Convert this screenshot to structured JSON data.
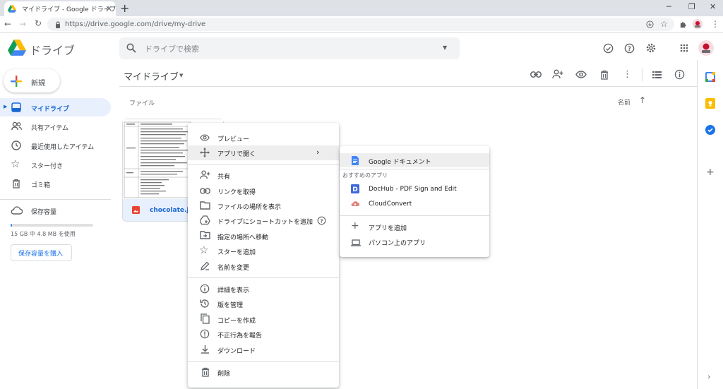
{
  "browser": {
    "tab_title": "マイドライブ - Google ドライブ",
    "url": "https://drive.google.com/drive/my-drive"
  },
  "header": {
    "app_name": "ドライブ",
    "search_placeholder": "ドライブで検索"
  },
  "sidebar": {
    "new_label": "新規",
    "items": [
      {
        "label": "マイドライブ",
        "icon": "drive-icon",
        "active": true
      },
      {
        "label": "共有アイテム",
        "icon": "people-icon"
      },
      {
        "label": "最近使用したアイテム",
        "icon": "clock-icon"
      },
      {
        "label": "スター付き",
        "icon": "star-icon"
      },
      {
        "label": "ゴミ箱",
        "icon": "trash-icon"
      }
    ],
    "storage_label": "保存容量",
    "storage_usage": "15 GB 中 4.8 MB を使用",
    "storage_used_fraction": 0.0003,
    "buy_storage_label": "保存容量を購入"
  },
  "main": {
    "title": "マイドライブ",
    "files_heading": "ファイル",
    "sort_label": "名前",
    "file": {
      "name": "chocolate.jpg"
    }
  },
  "context_menu": {
    "items": [
      {
        "label": "プレビュー",
        "icon": "eye-icon"
      },
      {
        "label": "アプリで開く",
        "icon": "move-icon",
        "highlighted": true,
        "submenu": true
      },
      {
        "label": "共有",
        "icon": "person-add-icon"
      },
      {
        "label": "リンクを取得",
        "icon": "link-icon"
      },
      {
        "label": "ファイルの場所を表示",
        "icon": "folder-icon"
      },
      {
        "label": "ドライブにショートカットを追加",
        "icon": "shortcut-icon",
        "help": true
      },
      {
        "label": "指定の場所へ移動",
        "icon": "folder-move-icon"
      },
      {
        "label": "スターを追加",
        "icon": "star-icon"
      },
      {
        "label": "名前を変更",
        "icon": "pencil-icon"
      },
      {
        "label": "詳細を表示",
        "icon": "info-icon"
      },
      {
        "label": "版を管理",
        "icon": "history-icon"
      },
      {
        "label": "コピーを作成",
        "icon": "copy-icon"
      },
      {
        "label": "不正行為を報告",
        "icon": "report-icon"
      },
      {
        "label": "ダウンロード",
        "icon": "download-icon"
      },
      {
        "label": "削除",
        "icon": "trash-icon"
      }
    ]
  },
  "submenu": {
    "top_item": "Google ドキュメント",
    "section_label": "おすすめのアプリ",
    "apps": [
      "DocHub - PDF Sign and Edit",
      "CloudConvert"
    ],
    "add_app": "アプリを追加",
    "computer_apps": "パソコン上のアプリ"
  }
}
